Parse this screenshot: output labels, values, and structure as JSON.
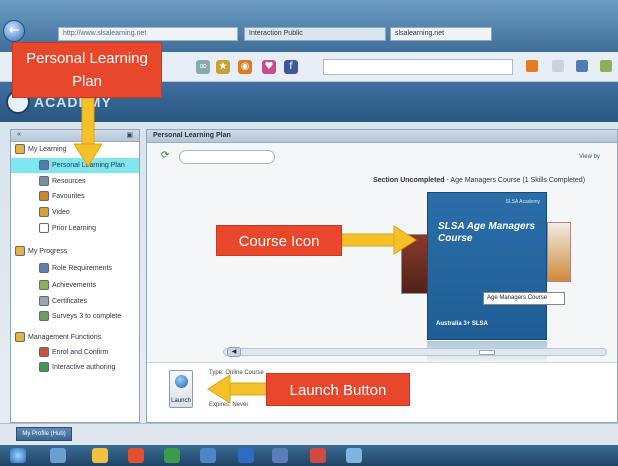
{
  "browser": {
    "address_text": "http://www.slsalearning.net",
    "tabs": [
      "Interaction Public",
      "slsalearning.net"
    ]
  },
  "app": {
    "logo_text": "ACADEMY"
  },
  "sidebar": {
    "items": [
      {
        "label": "My Learning",
        "icon": "folder-icon",
        "level": 0
      },
      {
        "label": "Personal Learning Plan",
        "icon": "plan-icon",
        "level": 1,
        "selected": true
      },
      {
        "label": "Resources",
        "icon": "resources-icon",
        "level": 1
      },
      {
        "label": "Favourites",
        "icon": "favourites-icon",
        "level": 1
      },
      {
        "label": "Video",
        "icon": "video-icon",
        "level": 1
      },
      {
        "label": "Prior Learning",
        "icon": "prior-icon",
        "level": 1
      },
      {
        "label": "My Progress",
        "icon": "folder-icon",
        "level": 0
      },
      {
        "label": "Role Requirements",
        "icon": "role-icon",
        "level": 1
      },
      {
        "label": "Achievements",
        "icon": "achievements-icon",
        "level": 1
      },
      {
        "label": "Certificates",
        "icon": "certificates-icon",
        "level": 1
      },
      {
        "label": "Surveys 3 to complete",
        "icon": "survey-icon",
        "level": 1
      },
      {
        "label": "Management Functions",
        "icon": "folder-icon",
        "level": 0
      },
      {
        "label": "Enrol and Confirm",
        "icon": "enrol-icon",
        "level": 1
      },
      {
        "label": "Interactive authoring",
        "icon": "authoring-icon",
        "level": 1
      }
    ]
  },
  "main": {
    "panel_title": "Personal Learning Plan",
    "view_by": "View by",
    "section_label": "Section Uncompleted",
    "section_detail": " - Age Managers Course (1 Skills Completed)",
    "course": {
      "brand": "SLSA Academy",
      "title": "SLSA Age Managers Course",
      "bottom": "Australia 3+ SLSA",
      "tooltip": "Age Managers Course"
    },
    "detail": {
      "type": "Type: Online Course",
      "expires": "Expires: Never",
      "launch_label": "Launch"
    }
  },
  "status": {
    "button_label": "My Profile (Hub)"
  },
  "annotations": {
    "plp": "Personal Learning Plan",
    "course_icon": "Course Icon",
    "launch_button": "Launch Button"
  },
  "colors": {
    "callout": "#e8472b",
    "arrow": "#f5c12a",
    "selected_row": "#7fe7f0",
    "course_tile": "#2b6ea8"
  }
}
